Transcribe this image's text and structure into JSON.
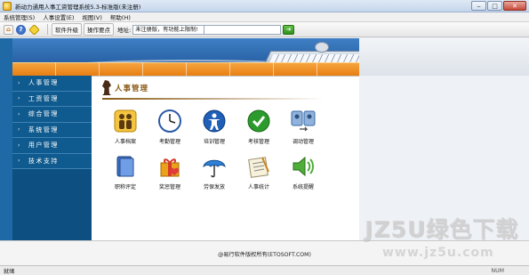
{
  "window": {
    "title": "新动力通用人事工资管理系统5.3-标准版(未注册)"
  },
  "menubar": {
    "items": [
      "系统管理(S)",
      "人事设置(E)",
      "视图(V)",
      "帮助(H)"
    ]
  },
  "toolbar": {
    "home_icon": "home-icon",
    "help_icon": "help-icon",
    "exit_icon": "exit-icon",
    "upgrade_label": "软件升级",
    "tips_label": "操作要点",
    "address_label": "地址:",
    "address_value": "未注册版，有功能上限制!",
    "go_icon": "go-arrow-icon"
  },
  "sidebar": {
    "items": [
      "人事管理",
      "工资管理",
      "综合管理",
      "系统管理",
      "用户管理",
      "技术支持"
    ]
  },
  "content": {
    "title": "人事管理",
    "modules": [
      {
        "label": "人事档案",
        "icon": "people-icon"
      },
      {
        "label": "考勤管理",
        "icon": "clock-icon"
      },
      {
        "label": "培训管理",
        "icon": "person-circle-icon"
      },
      {
        "label": "考核管理",
        "icon": "checkmark-icon"
      },
      {
        "label": "调动管理",
        "icon": "transfer-icon"
      },
      {
        "label": "职称评定",
        "icon": "book-icon"
      },
      {
        "label": "奖惩管理",
        "icon": "gift-heart-icon"
      },
      {
        "label": "劳保发放",
        "icon": "umbrella-icon"
      },
      {
        "label": "人事统计",
        "icon": "notepad-icon"
      },
      {
        "label": "系统提醒",
        "icon": "speaker-icon"
      }
    ]
  },
  "footer": {
    "copyright": "@易行软件版权所有(ETOSOFT.COM)"
  },
  "status": {
    "left": "就绪",
    "right": "NUM"
  },
  "watermark": {
    "main": "JZ5U绿色下载",
    "sub": "www.jz5u.com"
  }
}
